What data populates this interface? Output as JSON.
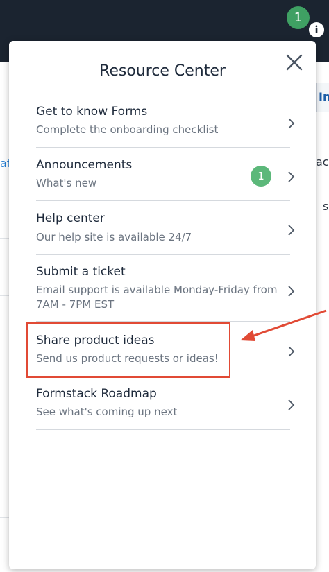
{
  "header": {
    "notification_count": "1",
    "info_icon": "info-icon"
  },
  "background": {
    "tab_fragment": "In",
    "link_fragment": "at",
    "right_fragment_1": "ac",
    "right_fragment_2": "s"
  },
  "panel": {
    "title": "Resource Center",
    "close_icon": "close-icon",
    "items": [
      {
        "title": "Get to know Forms",
        "subtitle": "Complete the onboarding checklist"
      },
      {
        "title": "Announcements",
        "subtitle": "What's new",
        "badge": "1"
      },
      {
        "title": "Help center",
        "subtitle": "Our help site is available 24/7"
      },
      {
        "title": "Submit a ticket",
        "subtitle": "Email support is available Monday-Friday from 7AM - 7PM EST"
      },
      {
        "title": "Share product ideas",
        "subtitle": "Send us product requests or ideas!"
      },
      {
        "title": "Formstack Roadmap",
        "subtitle": "See what's coming up next"
      }
    ]
  },
  "annotation": {
    "highlight_color": "#e14a35"
  },
  "colors": {
    "header_bg": "#1b2430",
    "badge_green": "#3fa063"
  }
}
